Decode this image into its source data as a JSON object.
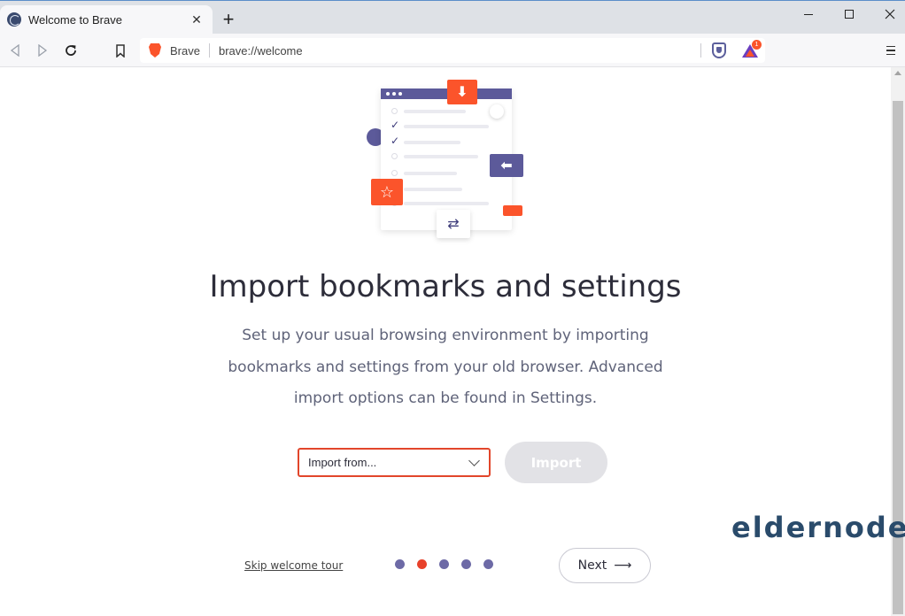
{
  "window": {
    "tab_title": "Welcome to Brave",
    "tab_close": "✕",
    "new_tab": "+"
  },
  "toolbar": {
    "site_label": "Brave",
    "url": "brave://welcome",
    "rewards_badge": "1"
  },
  "page": {
    "heading": "Import bookmarks and settings",
    "description": "Set up your usual browsing environment by importing bookmarks and settings from your old browser. Advanced import options can be found in Settings.",
    "import_select_value": "Import from...",
    "import_button": "Import",
    "skip_link": "Skip welcome tour",
    "next_button": "Next",
    "next_arrow": "⟶",
    "steps_total": 5,
    "steps_active": 2
  },
  "illustration": {
    "download_glyph": "⬇",
    "back_glyph": "⬅",
    "star_glyph": "☆",
    "swap_glyph": "⇄",
    "check_glyph": "✓"
  },
  "watermark": {
    "text": "eldernode"
  },
  "colors": {
    "accent": "#fb542b",
    "purple": "#5c5a9a",
    "select_border": "#e2462b"
  }
}
